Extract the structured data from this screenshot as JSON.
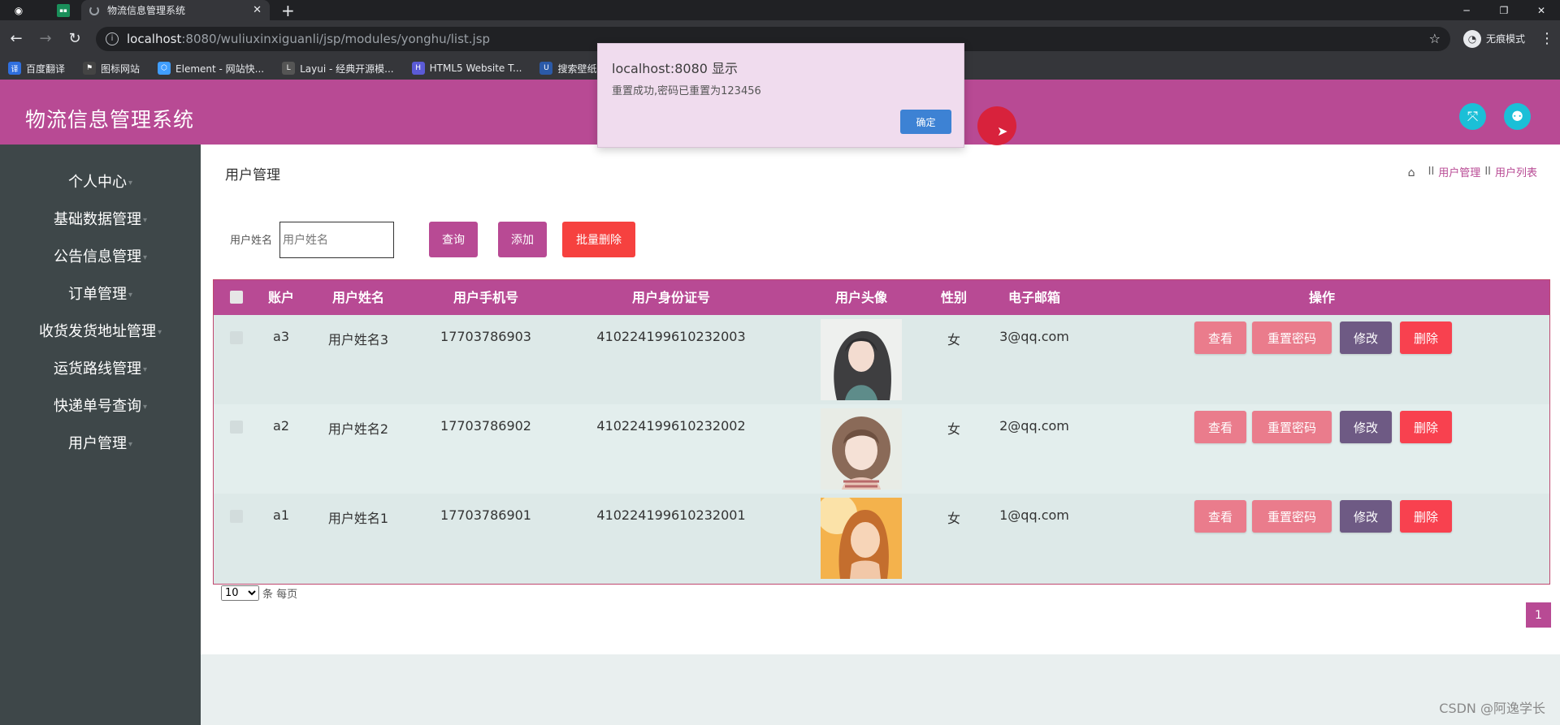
{
  "browser": {
    "tab_title": "物流信息管理系统",
    "tab_close": "✕",
    "new_tab": "+",
    "url_host": "localhost",
    "url_path": ":8080/wuliuxinxiguanli/jsp/modules/yonghu/list.jsp",
    "profile_label": "无痕模式",
    "bookmarks": [
      "百度翻译",
      "图标网站",
      "Element - 网站快...",
      "Layui - 经典开源模...",
      "HTML5 Website T...",
      "搜索壁纸"
    ]
  },
  "header": {
    "title": "物流信息管理系统"
  },
  "sidebar": {
    "items": [
      {
        "label": "个人中心"
      },
      {
        "label": "基础数据管理"
      },
      {
        "label": "公告信息管理"
      },
      {
        "label": "订单管理"
      },
      {
        "label": "收货发货地址管理"
      },
      {
        "label": "运货路线管理"
      },
      {
        "label": "快递单号查询"
      },
      {
        "label": "用户管理"
      }
    ]
  },
  "page": {
    "title": "用户管理",
    "breadcrumb": {
      "sep": "II",
      "first": "用户管理",
      "second": "用户列表"
    }
  },
  "search": {
    "label": "用户姓名",
    "placeholder": "用户姓名",
    "query_button": "查询",
    "add_button": "添加",
    "batch_delete_button": "批量删除"
  },
  "table": {
    "columns": [
      "账户",
      "用户姓名",
      "用户手机号",
      "用户身份证号",
      "用户头像",
      "性别",
      "电子邮箱",
      "操作"
    ],
    "rows": [
      {
        "account": "a3",
        "name": "用户姓名3",
        "phone": "17703786903",
        "id_card": "410224199610232003",
        "gender": "女",
        "email": "3@qq.com"
      },
      {
        "account": "a2",
        "name": "用户姓名2",
        "phone": "17703786902",
        "id_card": "410224199610232002",
        "gender": "女",
        "email": "2@qq.com"
      },
      {
        "account": "a1",
        "name": "用户姓名1",
        "phone": "17703786901",
        "id_card": "410224199610232001",
        "gender": "女",
        "email": "1@qq.com"
      }
    ],
    "actions": {
      "view": "查看",
      "reset_password": "重置密码",
      "edit": "修改",
      "delete": "删除"
    }
  },
  "pagination": {
    "page_size": "10",
    "per_page_label": "条 每页",
    "current_page": "1"
  },
  "dialog": {
    "title": "localhost:8080 显示",
    "message": "重置成功,密码已重置为123456",
    "ok_button": "确定"
  },
  "watermark": "CSDN @阿逸学长",
  "colors": {
    "brand": "#b84a94",
    "sidebar": "#3e4749",
    "view_button": "#ea7c8c",
    "edit_button": "#6e5a84",
    "delete_button": "#f8414f",
    "batch_delete": "#f6413f",
    "header_icon": "#1bbfd7"
  }
}
